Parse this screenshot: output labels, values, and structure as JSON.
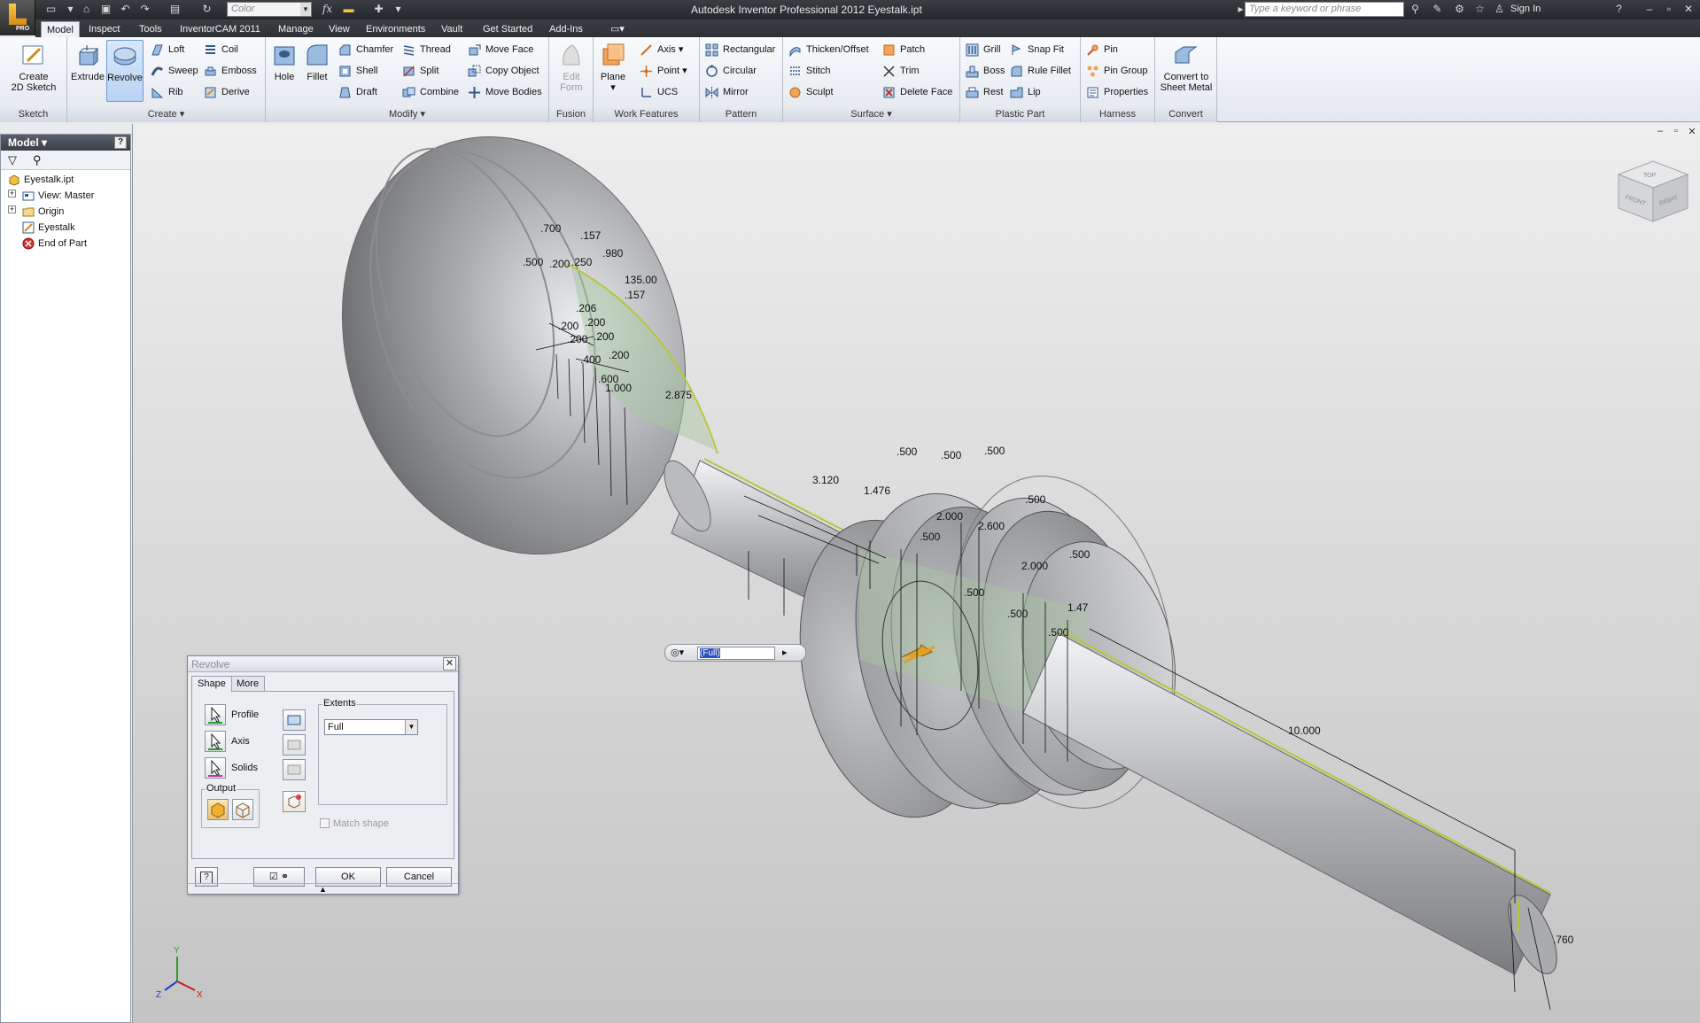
{
  "titlebar": {
    "title": "Autodesk Inventor Professional 2012    Eyestalk.ipt",
    "color_combo": "Color",
    "search_placeholder": "Type a keyword or phrase",
    "sign_in": "Sign In",
    "app_badge": "PRO",
    "fx": "fx"
  },
  "tabs": [
    "Model",
    "Inspect",
    "Tools",
    "InventorCAM 2011",
    "Manage",
    "View",
    "Environments",
    "Vault",
    "Get Started",
    "Add-Ins"
  ],
  "ribbon": {
    "sketch": {
      "label": "Sketch",
      "create_sketch": "Create\n2D Sketch"
    },
    "create": {
      "label": "Create",
      "extrude": "Extrude",
      "revolve": "Revolve",
      "loft": "Loft",
      "sweep": "Sweep",
      "rib": "Rib",
      "coil": "Coil",
      "emboss": "Emboss",
      "derive": "Derive"
    },
    "modify": {
      "label": "Modify",
      "hole": "Hole",
      "fillet": "Fillet",
      "chamfer": "Chamfer",
      "shell": "Shell",
      "draft": "Draft",
      "thread": "Thread",
      "split": "Split",
      "combine": "Combine",
      "move_face": "Move Face",
      "copy_object": "Copy Object",
      "move_bodies": "Move Bodies"
    },
    "fusion": {
      "label": "Fusion",
      "edit_form": "Edit\nForm"
    },
    "work": {
      "label": "Work Features",
      "plane": "Plane",
      "axis": "Axis",
      "point": "Point",
      "ucs": "UCS"
    },
    "pattern": {
      "label": "Pattern",
      "rectangular": "Rectangular",
      "circular": "Circular",
      "mirror": "Mirror"
    },
    "surface": {
      "label": "Surface",
      "thicken": "Thicken/Offset",
      "stitch": "Stitch",
      "sculpt": "Sculpt",
      "patch": "Patch",
      "trim": "Trim",
      "delete_face": "Delete Face"
    },
    "plastic": {
      "label": "Plastic Part",
      "grill": "Grill",
      "boss": "Boss",
      "rest": "Rest",
      "snap_fit": "Snap Fit",
      "rule_fillet": "Rule Fillet",
      "lip": "Lip"
    },
    "harness": {
      "label": "Harness",
      "pin": "Pin",
      "pin_group": "Pin Group",
      "properties": "Properties"
    },
    "convert": {
      "label": "Convert",
      "sheet_metal": "Convert to\nSheet Metal"
    }
  },
  "browser": {
    "title": "Model",
    "help": "?",
    "items": [
      "Eyestalk.ipt",
      "View: Master",
      "Origin",
      "Eyestalk",
      "End of Part"
    ]
  },
  "viewcube": {
    "top": "TOP",
    "front": "FRONT",
    "right": "RIGHT"
  },
  "dimensions": {
    "d700": ".700",
    "d157a": ".157",
    "d500a": ".500",
    "d200a": ".200",
    "d250": ".250",
    "d980": ".980",
    "d135": "135.00",
    "d157b": ".157",
    "d206": ".206",
    "d200b": ".200",
    "d200c": ".200",
    "d200d": ".200",
    "d200e": ".200",
    "d200f": ".200",
    "d400": ".400",
    "d600": ".600",
    "d1000": "1.000",
    "d2875": "2.875",
    "d3120": "3.120",
    "d1476a": "1.476",
    "d500b": ".500",
    "d500c": ".500",
    "d500d": ".500",
    "d2000a": "2.000",
    "d2600": "2.600",
    "d500e": ".500",
    "d500f": ".500",
    "d2000b": "2.000",
    "d500g": ".500",
    "d500h": ".500",
    "d500i": ".500",
    "d500j": ".500",
    "d1476b": "1.47",
    "d10000": "10.000",
    "d760": ".760"
  },
  "minitoolbar": {
    "value": "(Full)"
  },
  "triad": {
    "x": "X",
    "y": "Y",
    "z": "Z"
  },
  "dialog": {
    "title": "Revolve",
    "tab_shape": "Shape",
    "tab_more": "More",
    "profile": "Profile",
    "axis": "Axis",
    "solids": "Solids",
    "output": "Output",
    "extents": "Extents",
    "extent_value": "Full",
    "match_shape": "Match shape",
    "ok": "OK",
    "cancel": "Cancel",
    "help": "?"
  }
}
